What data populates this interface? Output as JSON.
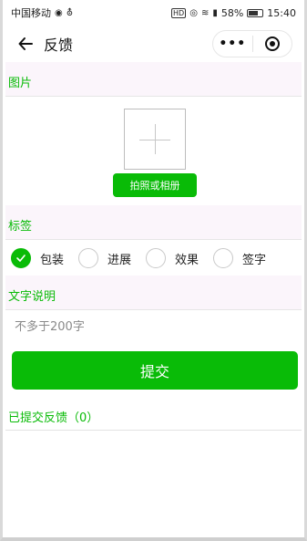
{
  "status_bar": {
    "carrier": "中国移动",
    "hd_badge": "HD",
    "battery_percent": "58%",
    "time": "15:40"
  },
  "nav": {
    "title": "反馈"
  },
  "sections": {
    "photo_title": "图片",
    "tags_title": "标签",
    "text_title": "文字说明",
    "submitted_title": "已提交反馈（0）"
  },
  "photo": {
    "button_label": "拍照或相册"
  },
  "tags": [
    {
      "label": "包装",
      "checked": true
    },
    {
      "label": "进展",
      "checked": false
    },
    {
      "label": "效果",
      "checked": false
    },
    {
      "label": "签字",
      "checked": false
    }
  ],
  "text_input": {
    "placeholder": "不多于200字",
    "value": ""
  },
  "submit": {
    "label": "提交"
  },
  "colors": {
    "accent": "#09bb07",
    "section_bg": "#fbf5fb"
  }
}
